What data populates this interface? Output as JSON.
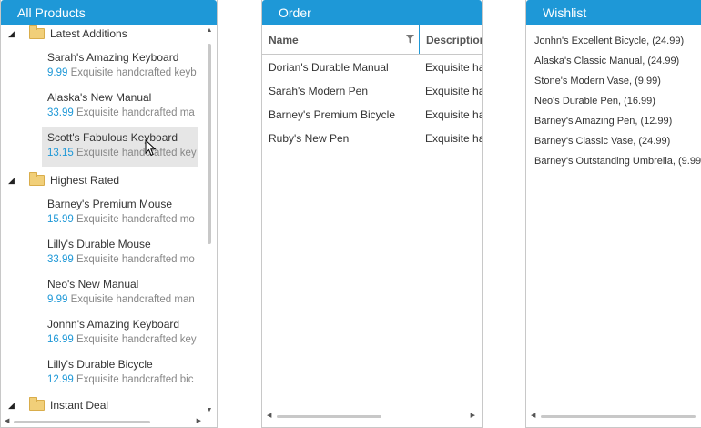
{
  "products_panel": {
    "title": "All Products",
    "groups": [
      {
        "label": "Latest Additions",
        "items": [
          {
            "name": "Sarah's Amazing Keyboard",
            "price": "9.99",
            "desc": "Exquisite handcrafted keyb"
          },
          {
            "name": "Alaska's New Manual",
            "price": "33.99",
            "desc": "Exquisite handcrafted ma"
          },
          {
            "name": "Scott's Fabulous Keyboard",
            "price": "13.15",
            "desc": "Exquisite handcrafted key"
          }
        ]
      },
      {
        "label": "Highest Rated",
        "items": [
          {
            "name": "Barney's Premium Mouse",
            "price": "15.99",
            "desc": "Exquisite handcrafted mo"
          },
          {
            "name": "Lilly's Durable Mouse",
            "price": "33.99",
            "desc": "Exquisite handcrafted mo"
          },
          {
            "name": "Neo's New Manual",
            "price": "9.99",
            "desc": "Exquisite handcrafted man"
          },
          {
            "name": "Jonhn's Amazing Keyboard",
            "price": "16.99",
            "desc": "Exquisite handcrafted key"
          },
          {
            "name": "Lilly's Durable Bicycle",
            "price": "12.99",
            "desc": "Exquisite handcrafted bic"
          }
        ]
      },
      {
        "label": "Instant Deal",
        "items": []
      }
    ]
  },
  "order_panel": {
    "title": "Order",
    "columns": {
      "name": "Name",
      "description": "Description"
    },
    "rows": [
      {
        "name": "Dorian's Durable Manual",
        "description": "Exquisite ha"
      },
      {
        "name": "Sarah's Modern Pen",
        "description": "Exquisite ha"
      },
      {
        "name": "Barney's Premium Bicycle",
        "description": "Exquisite ha"
      },
      {
        "name": "Ruby's New Pen",
        "description": "Exquisite ha"
      }
    ]
  },
  "wishlist_panel": {
    "title": "Wishlist",
    "items": [
      "Jonhn's Excellent Bicycle, (24.99)",
      "Alaska's Classic Manual, (24.99)",
      "Stone's Modern Vase, (9.99)",
      "Neo's Durable Pen, (16.99)",
      "Barney's Amazing Pen, (12.99)",
      "Barney's Classic Vase, (24.99)",
      "Barney's Outstanding Umbrella, (9.99"
    ]
  },
  "colors": {
    "accent": "#1e98d7",
    "hover_row": "#e6e6e6",
    "folder": "#f1cf79"
  }
}
